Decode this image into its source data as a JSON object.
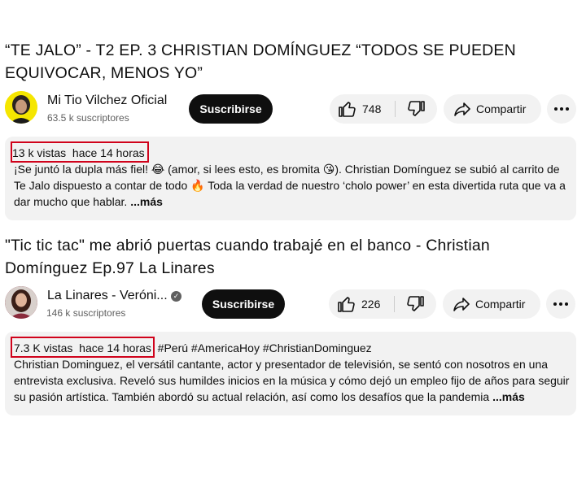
{
  "videos": [
    {
      "title": "“TE JALO” - T2 EP. 3 CHRISTIAN DOMÍNGUEZ “TODOS SE PUEDEN EQUIVOCAR, MENOS YO”",
      "channel": "Mi Tio Vilchez Oficial",
      "subscribers": "63.5 k suscriptores",
      "subscribe_label": "Suscribirse",
      "likes": "748",
      "share_label": "Compartir",
      "views": "13 k vistas",
      "age": "hace 14 horas",
      "tags": "",
      "description": "¡Se juntó la dupla más fiel! 😂 (amor, si lees esto, es bromita 😘). Christian Domínguez se subió al carrito de Te Jalo dispuesto a contar de todo 🔥 Toda la verdad de nuestro ‘cholo power’ en esta divertida ruta que va a dar mucho que hablar.",
      "more_label": "...más",
      "avatar_color": "#f5e600",
      "avatar_icon": "channel-avatar-photo"
    },
    {
      "title": "\"Tic tic tac\" me abrió puertas cuando trabajé en el banco - Christian Domínguez Ep.97 La Linares",
      "channel": "La Linares - Veróni...",
      "subscribers": "146 k suscriptores",
      "subscribe_label": "Suscribirse",
      "likes": "226",
      "share_label": "Compartir",
      "views": "7.3 K vistas",
      "age": "hace 14 horas",
      "tags": "#Perú #AmericaHoy #ChristianDominguez",
      "description": "Christian Dominguez, el versátil cantante, actor y presentador de televisión, se sentó con nosotros en una entrevista exclusiva. Reveló sus humildes inicios en la música y cómo dejó un empleo fijo de años para seguir su pasión artística. También abordó su actual relación, así como los desafíos que la pandemia",
      "more_label": "...más",
      "avatar_color": "#8a2b3c",
      "avatar_icon": "channel-avatar-photo"
    }
  ],
  "colors": {
    "highlight_box": "#d0021b",
    "subscribe_bg": "#0f0f0f",
    "pill_bg": "#f2f2f2"
  }
}
